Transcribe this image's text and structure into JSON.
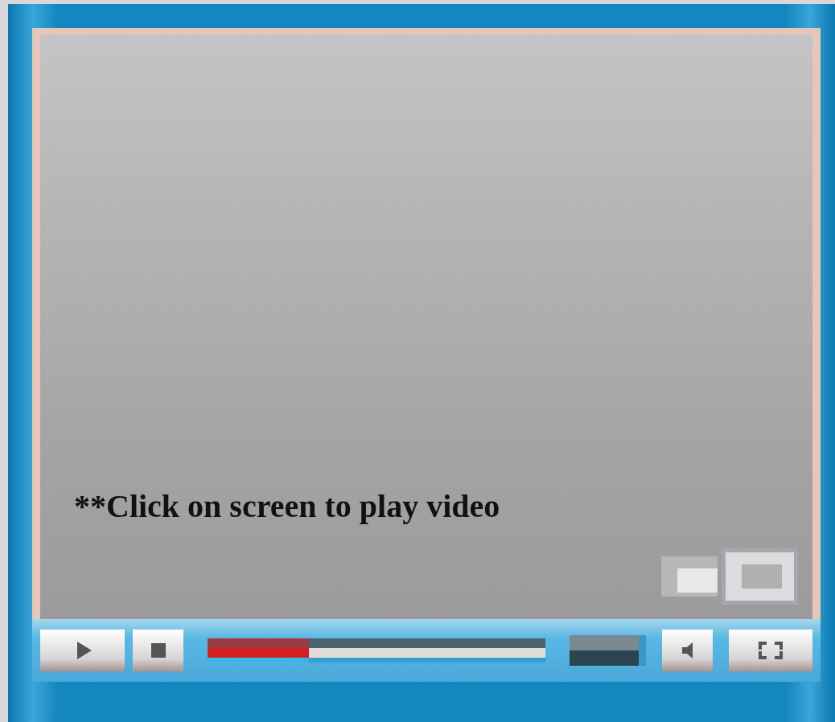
{
  "video": {
    "overlay_text": "**Click on screen to play video"
  },
  "controls": {
    "progress": {
      "level": 0.3
    },
    "volume": {
      "level": 0.9
    }
  }
}
